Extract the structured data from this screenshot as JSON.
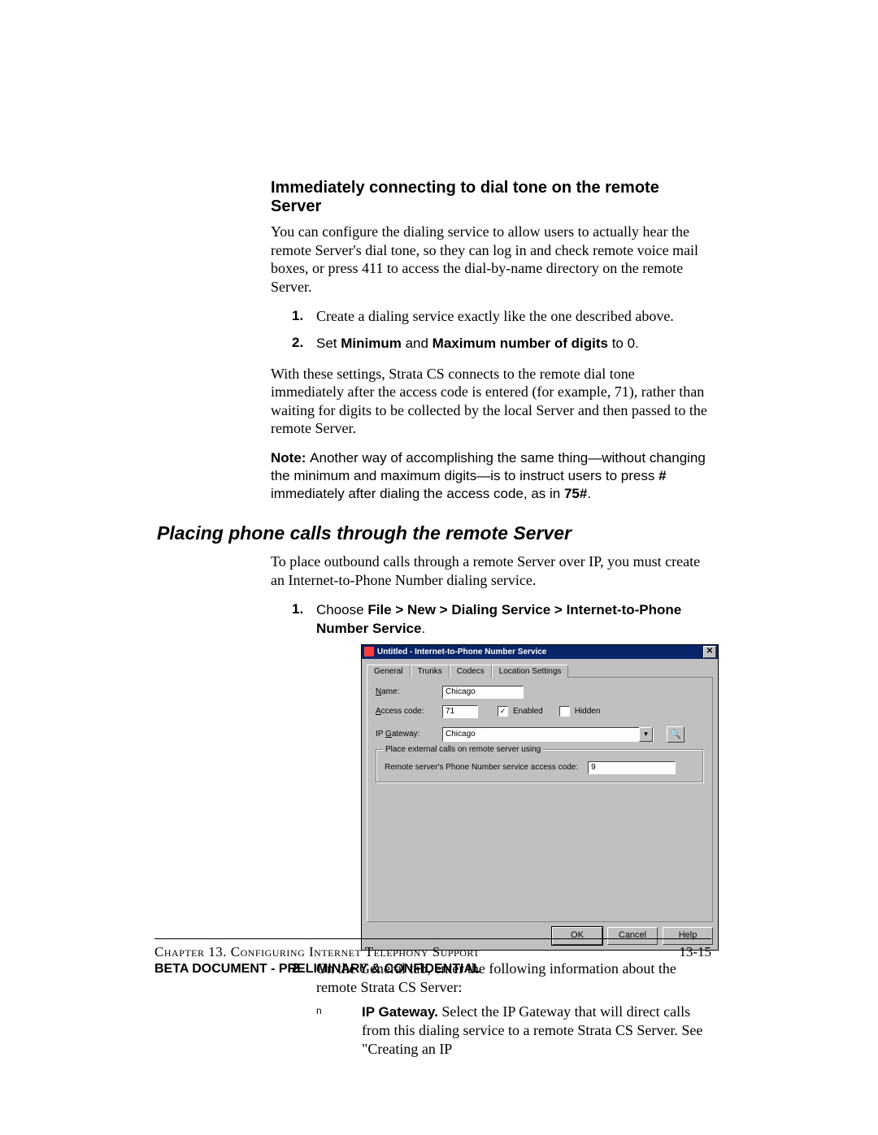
{
  "section1": {
    "heading": "Immediately connecting to dial tone on the remote Server",
    "intro": "You can configure the dialing service to allow users to actually hear the remote Server's dial tone, so they can log in and check remote voice mail boxes, or press 411 to access the dial-by-name directory on the remote Server.",
    "steps": [
      {
        "text": "Create a dialing service exactly like the one described above."
      },
      {
        "pre": "Set ",
        "b1": "Minimum",
        "mid": " and ",
        "b2": "Maximum number of digits",
        "post": " to 0."
      }
    ],
    "para2": "With these settings, Strata CS connects to the remote dial tone immediately after the access code is entered (for example, 71), rather than waiting for digits to be collected by the local Server and then passed to the remote Server.",
    "note": {
      "label": "Note:  ",
      "body1": "Another way of accomplishing the same thing—without changing the minimum and maximum digits—is to instruct users to press ",
      "hash": "#",
      "body2": " immediately after dialing the access code, as in ",
      "code": "75#",
      "body3": "."
    }
  },
  "section2": {
    "heading": "Placing phone calls through the remote Server",
    "intro": "To place outbound calls through a remote Server over IP, you must create an Internet-to-Phone Number dialing service.",
    "step1": {
      "pre": "Choose ",
      "bold": "File > New > Dialing Service > Internet-to-Phone Number Service",
      "post": "."
    },
    "step2": "On the General tab, enter the following information about the remote Strata CS Server:",
    "bullet": {
      "b": "IP Gateway.",
      "text": " Select the IP Gateway that will direct calls from this dialing service to a remote Strata CS Server. See \"Creating an IP"
    }
  },
  "dialog": {
    "title": "Untitled - Internet-to-Phone Number Service",
    "tabs": [
      "General",
      "Trunks",
      "Codecs",
      "Location Settings"
    ],
    "name_label": "Name:",
    "name_value": "Chicago",
    "access_label": "Access code:",
    "access_value": "71",
    "enabled_label": "Enabled",
    "hidden_label": "Hidden",
    "ip_label": "IP Gateway:",
    "ip_value": "Chicago",
    "group_legend": "Place external calls on remote server using",
    "remote_label": "Remote server's Phone Number service access code:",
    "remote_value": "9",
    "btn_ok": "OK",
    "btn_cancel": "Cancel",
    "btn_help": "Help"
  },
  "footer": {
    "chapter": "Chapter 13. Configuring Internet Telephony Support",
    "pagenum": "13-15",
    "confidential": "BETA DOCUMENT - PRELIMINARY & CONFIDENTIAL"
  }
}
